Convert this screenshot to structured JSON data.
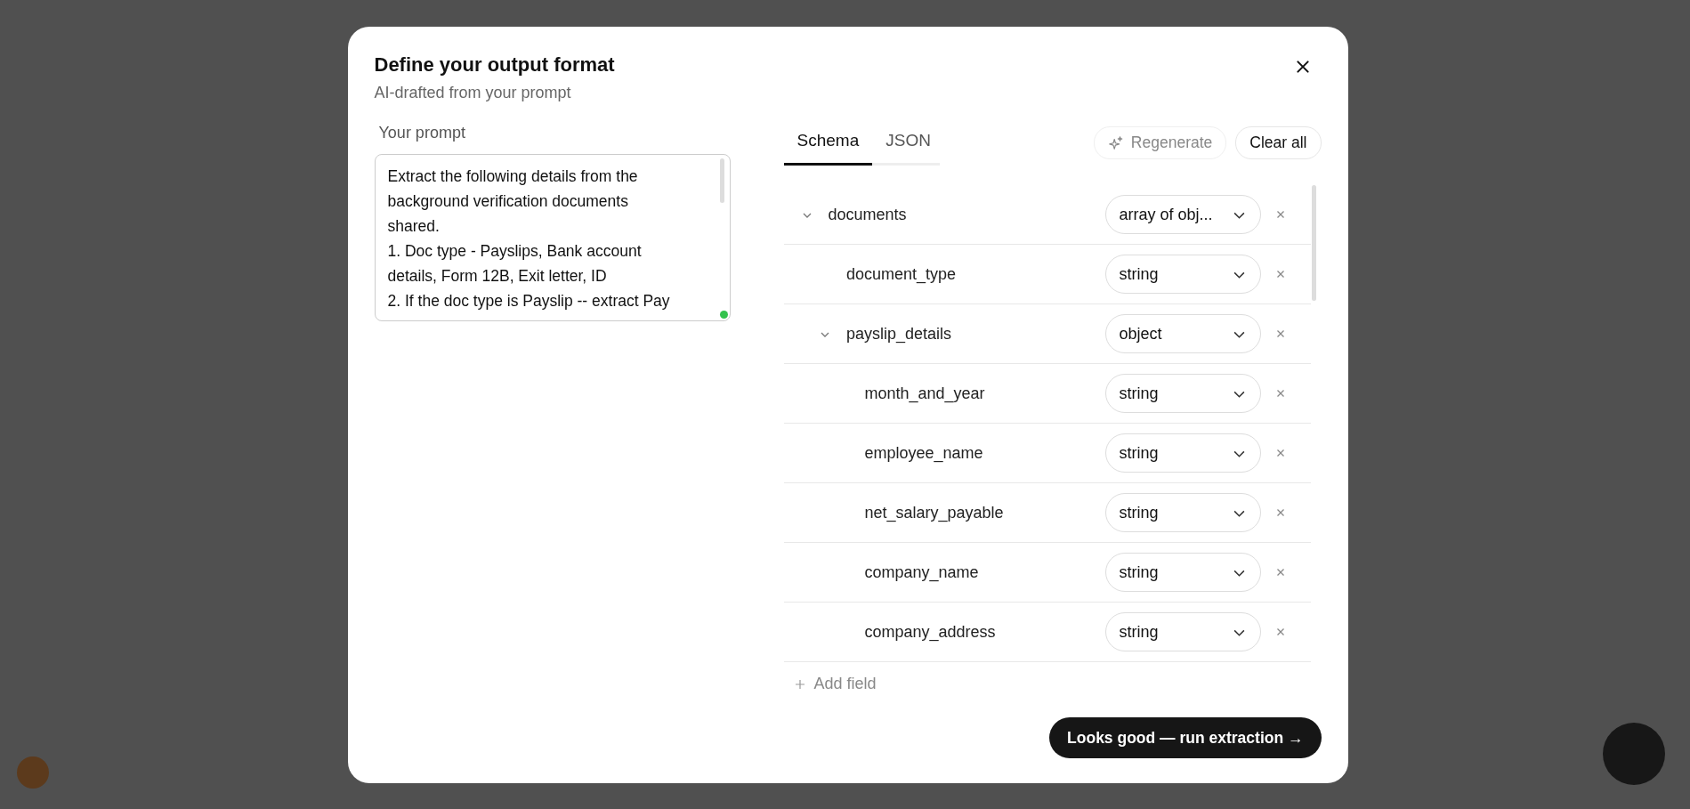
{
  "dialog": {
    "title": "Define your output format",
    "subtitle": "AI-drafted from your prompt"
  },
  "prompt": {
    "label": "Your prompt",
    "lines": [
      "Extract the following details from the",
      "background verification documents",
      "shared.",
      "1. Doc type - Payslips, Bank account",
      "details, Form 12B, Exit letter, ID",
      "2. If the doc type is Payslip -- extract Pay"
    ]
  },
  "tabs": [
    {
      "label": "Schema",
      "selected": true
    },
    {
      "label": "JSON",
      "selected": false
    }
  ],
  "actions": {
    "regenerate": {
      "label": "Regenerate",
      "disabled": true
    },
    "clear": {
      "label": "Clear all"
    }
  },
  "schema": {
    "fields": [
      {
        "name": "documents",
        "type": "array of obj...",
        "expanded": true,
        "children": [
          {
            "name": "document_type",
            "type": "string"
          },
          {
            "name": "payslip_details",
            "type": "object",
            "expanded": true,
            "children": [
              {
                "name": "month_and_year",
                "type": "string"
              },
              {
                "name": "employee_name",
                "type": "string"
              },
              {
                "name": "net_salary_payable",
                "type": "string"
              },
              {
                "name": "company_name",
                "type": "string"
              },
              {
                "name": "company_address",
                "type": "string"
              }
            ]
          }
        ]
      }
    ],
    "add_label": "Add field"
  },
  "primary_button": "Looks good — run extraction →"
}
